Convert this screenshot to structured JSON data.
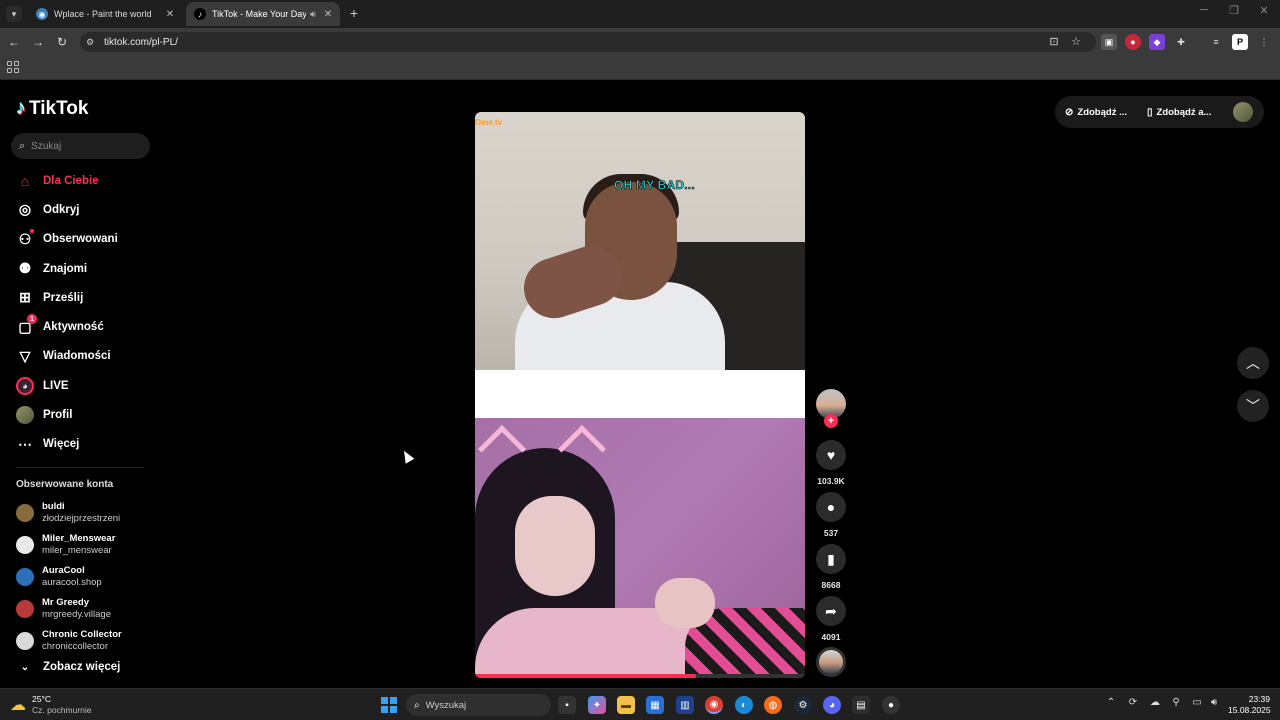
{
  "browser": {
    "tabs": [
      {
        "title": "Wplace - Paint the world",
        "active": false
      },
      {
        "title": "TikTok - Make Your Day",
        "active": true
      }
    ],
    "url": "tiktok.com/pl-PL/"
  },
  "tiktok": {
    "logo_text": "TikTok",
    "search_placeholder": "Szukaj",
    "nav": [
      {
        "label": "Dla Ciebie",
        "icon": "home-icon"
      },
      {
        "label": "Odkryj",
        "icon": "compass-icon"
      },
      {
        "label": "Obserwowani",
        "icon": "following-icon"
      },
      {
        "label": "Znajomi",
        "icon": "friends-icon"
      },
      {
        "label": "Prześlij",
        "icon": "upload-icon"
      },
      {
        "label": "Aktywność",
        "icon": "activity-icon",
        "badge": "1"
      },
      {
        "label": "Wiadomości",
        "icon": "messages-icon"
      },
      {
        "label": "LIVE",
        "icon": "live-icon"
      },
      {
        "label": "Profil",
        "icon": "profile-icon"
      },
      {
        "label": "Więcej",
        "icon": "more-icon"
      }
    ],
    "following_header": "Obserwowane konta",
    "following": [
      {
        "name": "buldi",
        "handle": "złodziejprzestrzeni",
        "color": "#8a6b3a"
      },
      {
        "name": "Miler_Menswear",
        "handle": "miler_menswear",
        "color": "#e8e8e8"
      },
      {
        "name": "AuraCool",
        "handle": "auracool.shop",
        "color": "#2a6fb8"
      },
      {
        "name": "Mr Greedy",
        "handle": "mrgreedy.village",
        "color": "#b83a3a"
      },
      {
        "name": "Chronic Collector",
        "handle": "chroniccollector",
        "color": "#d9d9d9"
      }
    ],
    "see_more": "Zobacz więcej",
    "video": {
      "watermark": "Ome.tv",
      "caption": "OH MY BAD...",
      "progress": 0.67
    },
    "actions": {
      "likes": "103.9K",
      "comments": "537",
      "saves": "8668",
      "shares": "4091"
    },
    "top_right": {
      "btn1": "Zdobądź ...",
      "btn2": "Zdobądź a..."
    }
  },
  "taskbar": {
    "weather_temp": "25°C",
    "weather_desc": "Cz. pochmurnie",
    "search_placeholder": "Wyszukaj",
    "time": "23:39",
    "date": "15.08.2025"
  },
  "colors": {
    "accent": "#fe2c55"
  }
}
